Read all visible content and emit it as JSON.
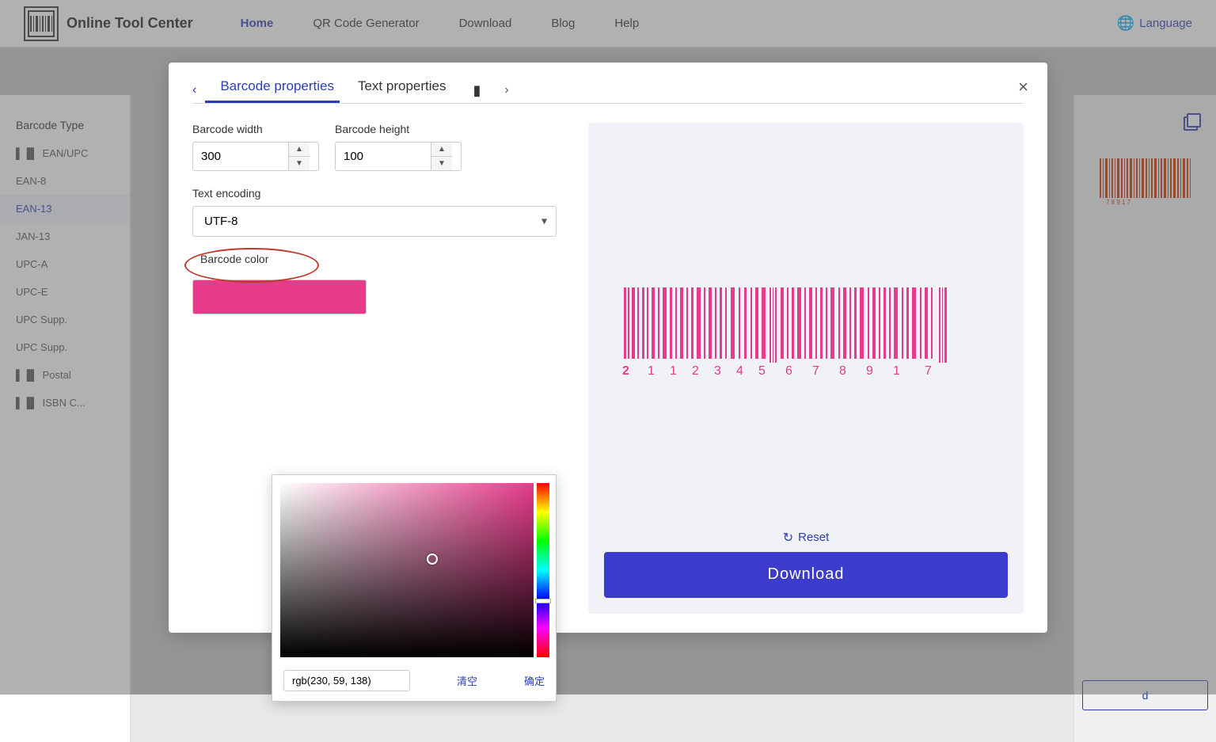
{
  "header": {
    "logo_text": "Online Tool Center",
    "nav": [
      {
        "label": "Home",
        "active": true
      },
      {
        "label": "QR Code Generator",
        "active": false
      },
      {
        "label": "Download",
        "active": false
      },
      {
        "label": "Blog",
        "active": false
      },
      {
        "label": "Help",
        "active": false
      }
    ],
    "language_label": "Language"
  },
  "sidebar": {
    "title": "Barcode Type",
    "items": [
      {
        "label": "EAN/UPC",
        "icon": "barcode",
        "active": false
      },
      {
        "label": "EAN-8",
        "active": false
      },
      {
        "label": "EAN-13",
        "active": true
      },
      {
        "label": "JAN-13",
        "active": false
      },
      {
        "label": "UPC-A",
        "active": false
      },
      {
        "label": "UPC-E",
        "active": false
      },
      {
        "label": "UPC Supp.",
        "active": false
      },
      {
        "label": "UPC Supp.",
        "active": false
      },
      {
        "label": "Postal",
        "icon": "barcode",
        "active": false
      },
      {
        "label": "ISBN C...",
        "icon": "barcode",
        "active": false
      }
    ]
  },
  "modal": {
    "tab_barcode": "Barcode properties",
    "tab_text": "Text properties",
    "close_label": "×",
    "barcode_width_label": "Barcode width",
    "barcode_width_value": "300",
    "barcode_height_label": "Barcode height",
    "barcode_height_value": "100",
    "encoding_label": "Text encoding",
    "encoding_value": "UTF-8",
    "color_label": "Barcode color",
    "color_value": "rgb(230, 59, 138)",
    "reset_label": "Reset",
    "download_label": "Download"
  },
  "color_picker": {
    "value": "rgb(230, 59, 138)",
    "clear_label": "清空",
    "confirm_label": "确定"
  },
  "barcode_digits": [
    "2",
    "1",
    "1",
    "2",
    "3",
    "4",
    "5",
    "6",
    "7",
    "8",
    "9",
    "1",
    "7"
  ]
}
